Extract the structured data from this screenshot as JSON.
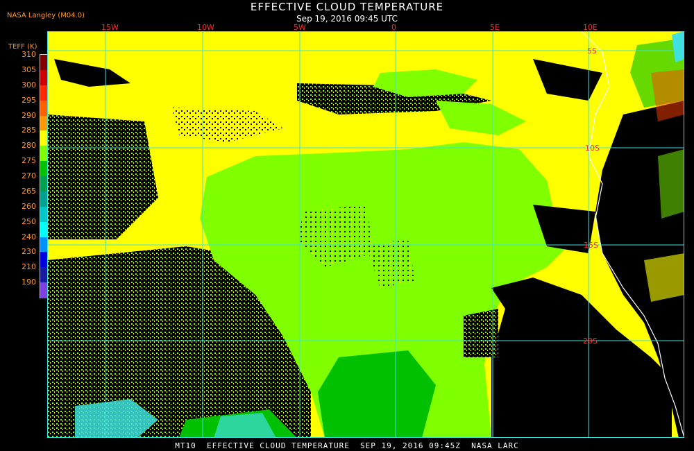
{
  "title": "EFFECTIVE CLOUD TEMPERATURE",
  "subtitle": "Sep 19, 2016 09:45 UTC",
  "provider": "NASA Langley (M04.0)",
  "legend": {
    "title": "TEFF (K)",
    "labels": [
      "310",
      "305",
      "300",
      "295",
      "290",
      "285",
      "280",
      "275",
      "270",
      "265",
      "260",
      "250",
      "240",
      "230",
      "210",
      "190"
    ],
    "colors": [
      "#800000",
      "#cc0000",
      "#ff2a00",
      "#ff6000",
      "#ff9900",
      "#ffff00",
      "#80ff00",
      "#00c000",
      "#00a050",
      "#00a090",
      "#00c8c8",
      "#00ffff",
      "#0090ff",
      "#0000e0",
      "#1a1aa0",
      "#8040e0"
    ]
  },
  "map": {
    "lon_labels": [
      "15W",
      "10W",
      "5W",
      "0",
      "5E",
      "10E"
    ],
    "lat_labels": [
      "5S",
      "10S",
      "15S",
      "20S"
    ],
    "colors": {
      "yellow": "#ffff00",
      "lime": "#80ff00",
      "green": "#00c000",
      "cyan": "#40e0e0",
      "grid": "#40e0e0",
      "coast": "#ffffff",
      "land_red": "#ff4000"
    }
  },
  "footer": "MT10  EFFECTIVE CLOUD TEMPERATURE  SEP 19, 2016 09:45Z  NASA LARC"
}
